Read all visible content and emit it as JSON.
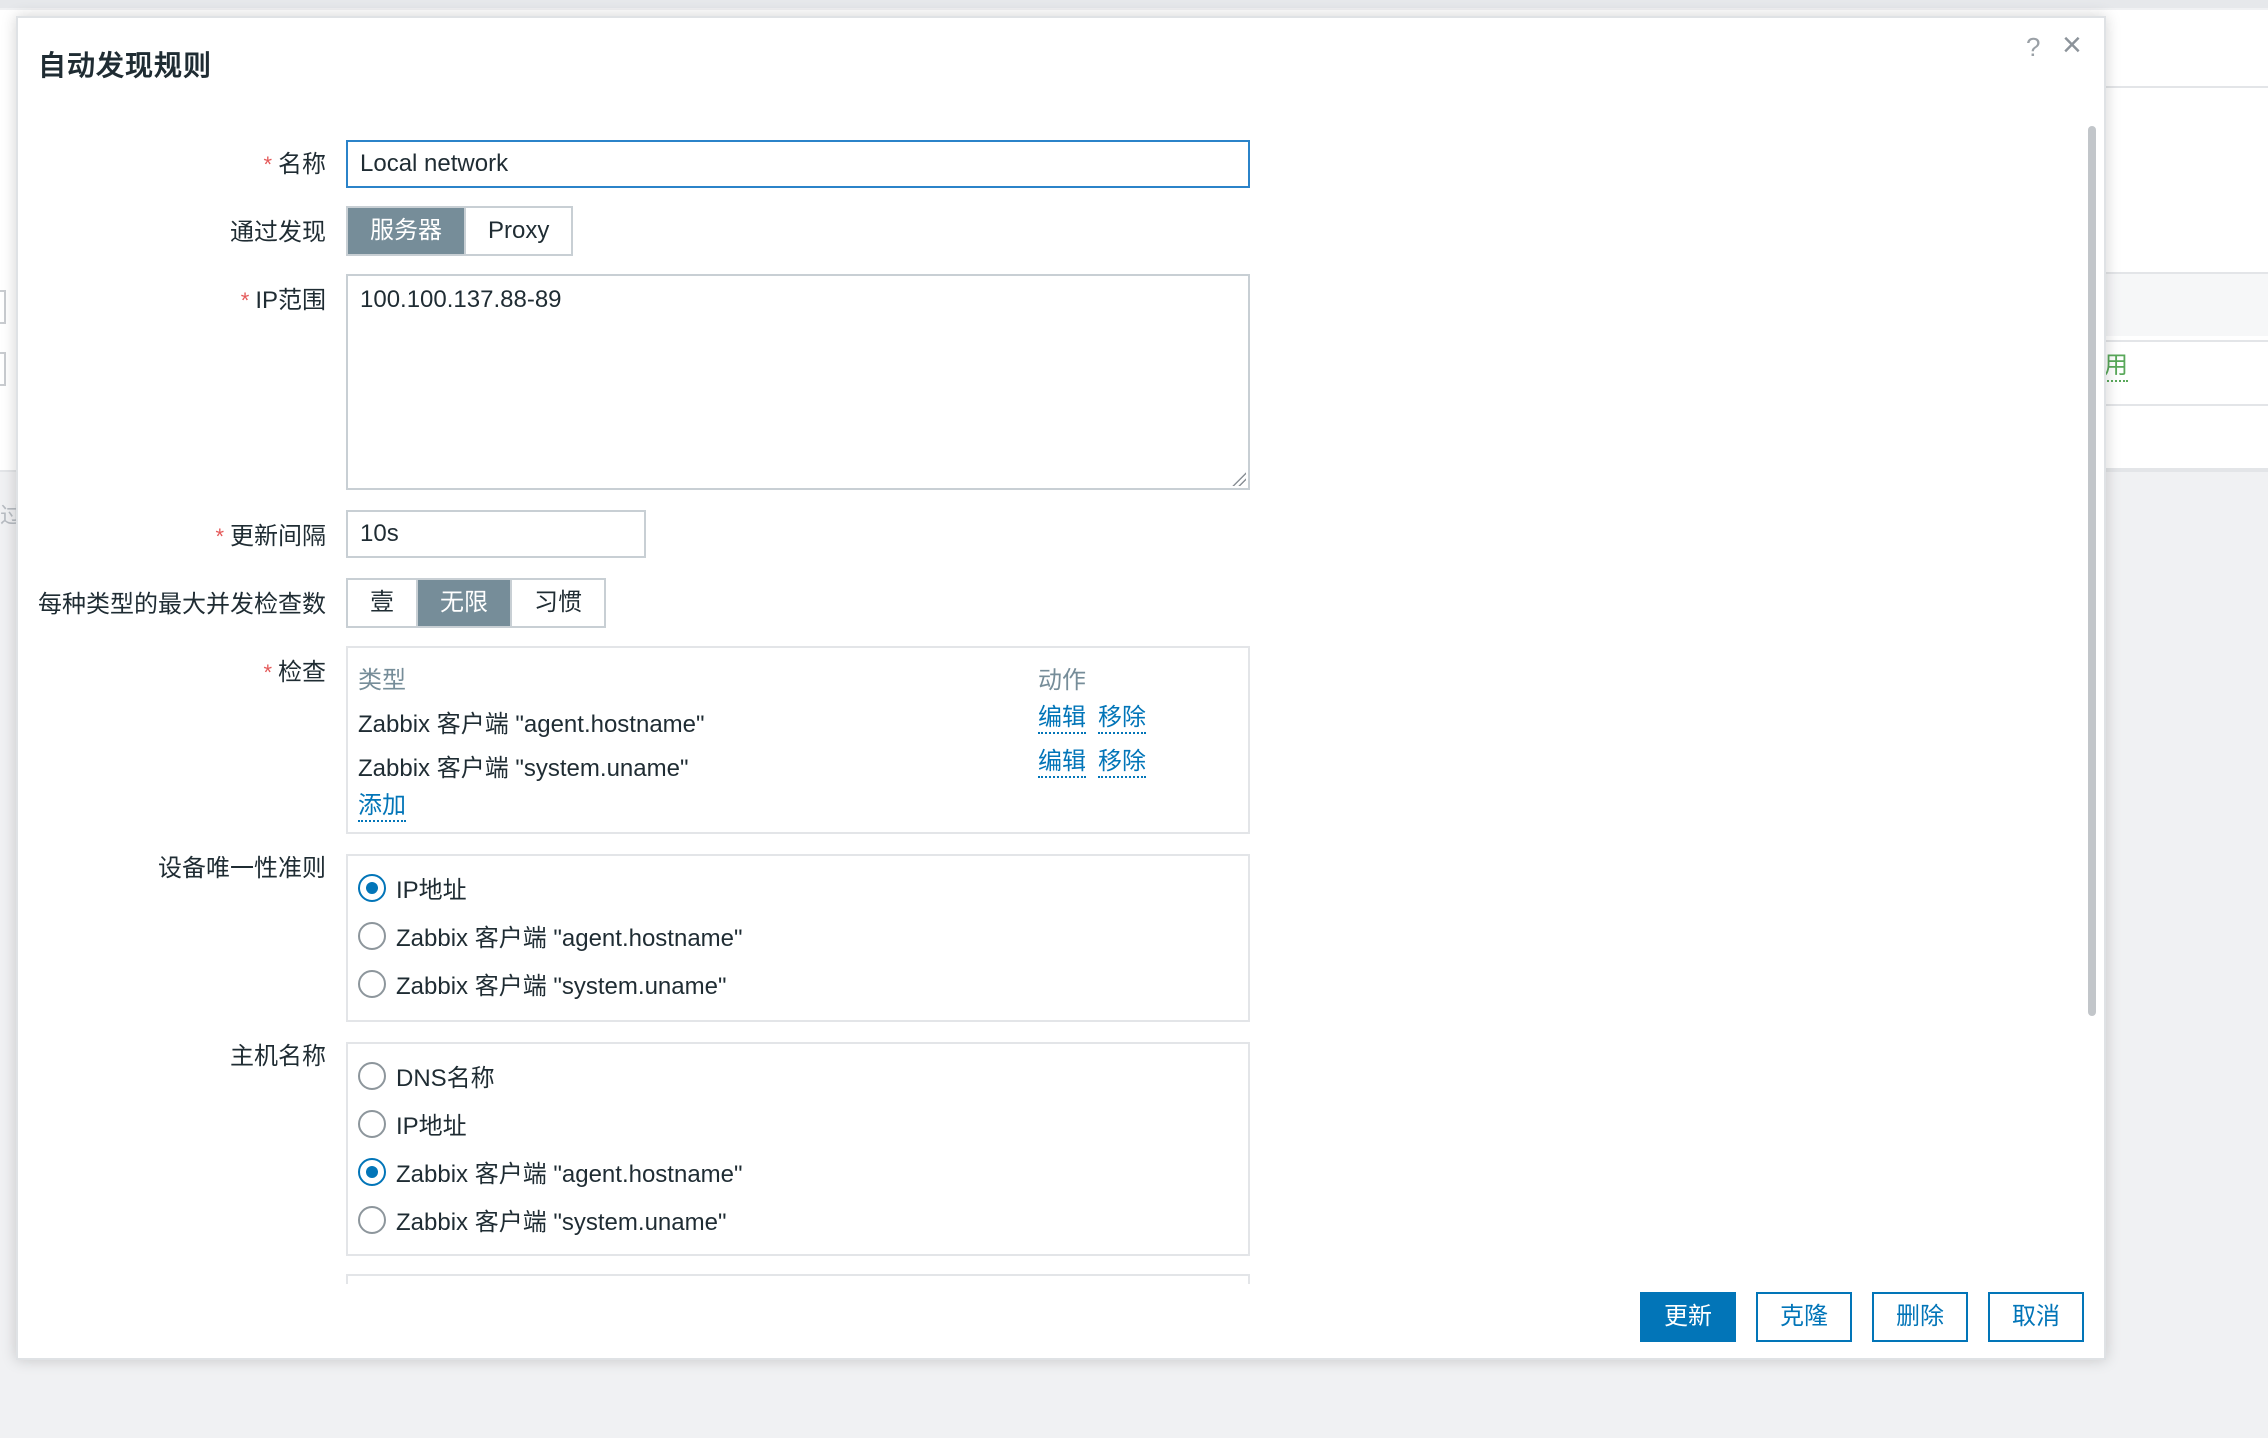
{
  "dialog": {
    "title": "自动发现规则",
    "help_icon": "?",
    "close_icon": "×"
  },
  "background": {
    "status_text": "用",
    "left_fragment": "过"
  },
  "form": {
    "name": {
      "label": "名称",
      "required_mark": "*",
      "value": "Local network"
    },
    "discovery_by": {
      "label": "通过发现",
      "options": [
        "服务器",
        "Proxy"
      ],
      "selected": "服务器"
    },
    "ip_range": {
      "label": "IP范围",
      "required_mark": "*",
      "value": "100.100.137.88-89"
    },
    "update_interval": {
      "label": "更新间隔",
      "required_mark": "*",
      "value": "10s"
    },
    "max_concurrent": {
      "label": "每种类型的最大并发检查数",
      "options": [
        "壹",
        "无限",
        "习惯"
      ],
      "selected": "无限"
    },
    "checks": {
      "label": "检查",
      "required_mark": "*",
      "col_type": "类型",
      "col_action": "动作",
      "rows": [
        {
          "type": "Zabbix 客户端 \"agent.hostname\"",
          "edit": "编辑",
          "remove": "移除"
        },
        {
          "type": "Zabbix 客户端 \"system.uname\"",
          "edit": "编辑",
          "remove": "移除"
        }
      ],
      "add_link": "添加"
    },
    "uniqueness": {
      "label": "设备唯一性准则",
      "options": [
        "IP地址",
        "Zabbix 客户端 \"agent.hostname\"",
        "Zabbix 客户端 \"system.uname\""
      ],
      "selected_index": 0
    },
    "host_name": {
      "label": "主机名称",
      "options": [
        "DNS名称",
        "IP地址",
        "Zabbix 客户端 \"agent.hostname\"",
        "Zabbix 客户端 \"system.uname\""
      ],
      "selected_index": 2
    }
  },
  "footer": {
    "update": "更新",
    "clone": "克隆",
    "delete": "删除",
    "cancel": "取消"
  },
  "colors": {
    "primary": "#0275b8",
    "segment_active": "#768d99",
    "required": "#e45959",
    "enabled_green": "#59a85a"
  }
}
